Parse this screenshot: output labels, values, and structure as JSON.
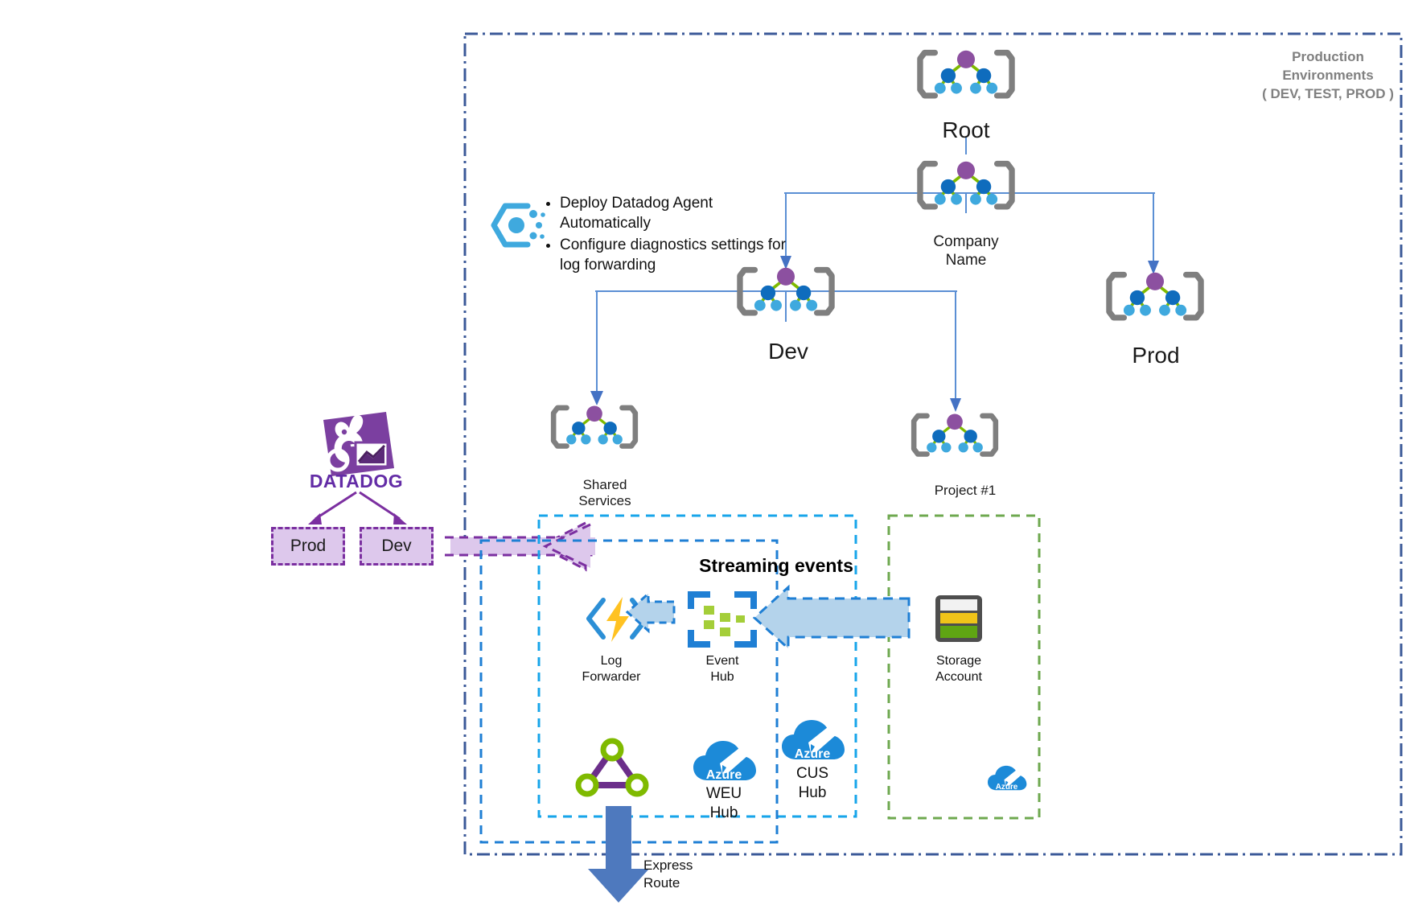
{
  "diagram": {
    "title": "Azure management group hierarchy with Datadog log forwarding",
    "boundary": {
      "name": "production-environments-boundary",
      "label_line1": "Production",
      "label_line2": "Environments",
      "label_line3": "( DEV, TEST, PROD )",
      "color": "#3b5998"
    },
    "management_groups": [
      {
        "id": "root",
        "label": "Root",
        "label2": ""
      },
      {
        "id": "company",
        "label": "Company",
        "label2": "Name"
      },
      {
        "id": "dev",
        "label": "Dev",
        "label2": ""
      },
      {
        "id": "prod",
        "label": "Prod",
        "label2": ""
      },
      {
        "id": "shared-services",
        "label": "Shared",
        "label2": "Services"
      },
      {
        "id": "project1",
        "label": "Project #1",
        "label2": ""
      }
    ],
    "policy_callout": {
      "icon": "azure-policy-icon",
      "bullets": [
        "Deploy Datadog Agent Automatically",
        "Configure diagnostics settings for log forwarding"
      ]
    },
    "datadog": {
      "logo_text": "DATADOG",
      "accent": "#632CA6",
      "boxes": [
        {
          "id": "datadog-prod",
          "label": "Prod"
        },
        {
          "id": "datadog-dev",
          "label": "Dev"
        }
      ]
    },
    "regions": {
      "cyan": {
        "name": "shared-services-region-weu",
        "color": "#17A5EA"
      },
      "blue": {
        "name": "shared-services-region-cus",
        "color": "#1F7FD4"
      },
      "green": {
        "name": "project1-region",
        "color": "#6EA84F"
      }
    },
    "resources": [
      {
        "id": "log-forwarder",
        "icon": "azure-function-icon",
        "label": "Log",
        "label2": "Forwarder"
      },
      {
        "id": "event-hub",
        "icon": "event-hub-icon",
        "label": "Event",
        "label2": "Hub"
      },
      {
        "id": "storage-account",
        "icon": "storage-account-icon",
        "label": "Storage",
        "label2": "Account"
      },
      {
        "id": "virtual-network",
        "icon": "virtual-network-icon",
        "label": "",
        "label2": ""
      },
      {
        "id": "weu-hub",
        "icon": "azure-blueprint-icon",
        "label": "WEU",
        "label2": "Hub"
      },
      {
        "id": "cus-hub",
        "icon": "azure-blueprint-icon",
        "label": "CUS",
        "label2": "Hub"
      },
      {
        "id": "project1-blueprint",
        "icon": "azure-blueprint-icon",
        "label": "",
        "label2": ""
      }
    ],
    "flows": {
      "streaming_events": "Streaming events",
      "express_route_line1": "Express",
      "express_route_line2": "Route"
    },
    "azure_cloud_text": "Azure"
  }
}
